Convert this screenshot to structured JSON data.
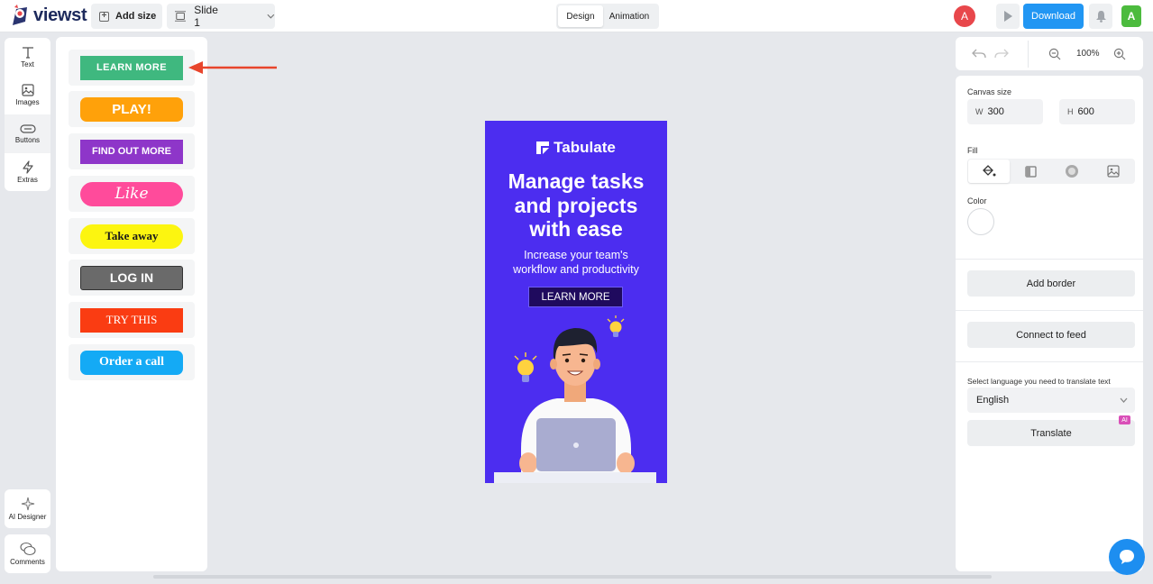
{
  "app": {
    "logo_text": "viewst"
  },
  "topbar": {
    "add_size_label": "Add size",
    "slide_label": "Slide 1",
    "tabs": [
      {
        "label": "Design"
      },
      {
        "label": "Animation"
      }
    ],
    "user_initial": "A",
    "download_label": "Download",
    "account_initial": "A"
  },
  "rail": {
    "items": [
      {
        "label": "Text",
        "icon": "text-icon"
      },
      {
        "label": "Images",
        "icon": "image-icon"
      },
      {
        "label": "Buttons",
        "icon": "button-icon"
      },
      {
        "label": "Extras",
        "icon": "lightning-icon"
      }
    ],
    "ai_designer_label": "AI Designer",
    "comments_label": "Comments"
  },
  "buttons_panel": {
    "items": [
      {
        "label": "LEARN MORE",
        "bg": "#3fb87f",
        "color": "#ffffff"
      },
      {
        "label": "PLAY!",
        "bg": "#ffa10a",
        "color": "#ffffff"
      },
      {
        "label": "FIND OUT MORE",
        "bg": "#8e36c9",
        "color": "#ffffff"
      },
      {
        "label": "Like",
        "bg": "#ff4b9b",
        "color": "#ffffff"
      },
      {
        "label": "Take away",
        "bg": "#fcf510",
        "color": "#1a1a1a"
      },
      {
        "label": "LOG IN",
        "bg": "#6a6a6a",
        "color": "#ffffff"
      },
      {
        "label": "TRY THIS",
        "bg": "#fa3c12",
        "color": "#ffffff"
      },
      {
        "label": "Order a call",
        "bg": "#14aaf5",
        "color": "#ffffff"
      }
    ]
  },
  "canvas": {
    "brand": "Tabulate",
    "headline_lines": [
      "Manage tasks",
      "and projects",
      "with ease"
    ],
    "subtitle_lines": [
      "Increase your team's",
      "workflow and productivity"
    ],
    "cta_label": "LEARN MORE",
    "background": "#4c2df0"
  },
  "right_panel": {
    "zoom_label": "100%",
    "canvas_size_label": "Canvas size",
    "width_prefix": "W",
    "width_value": "300",
    "height_prefix": "H",
    "height_value": "600",
    "fill_label": "Fill",
    "color_label": "Color",
    "add_border_label": "Add border",
    "connect_feed_label": "Connect to feed",
    "translate_prompt": "Select language you need to translate text",
    "language_value": "English",
    "translate_label": "Translate",
    "ai_badge": "AI"
  },
  "colors": {
    "accent": "#2196f3",
    "annotation_arrow": "#e8452c"
  }
}
